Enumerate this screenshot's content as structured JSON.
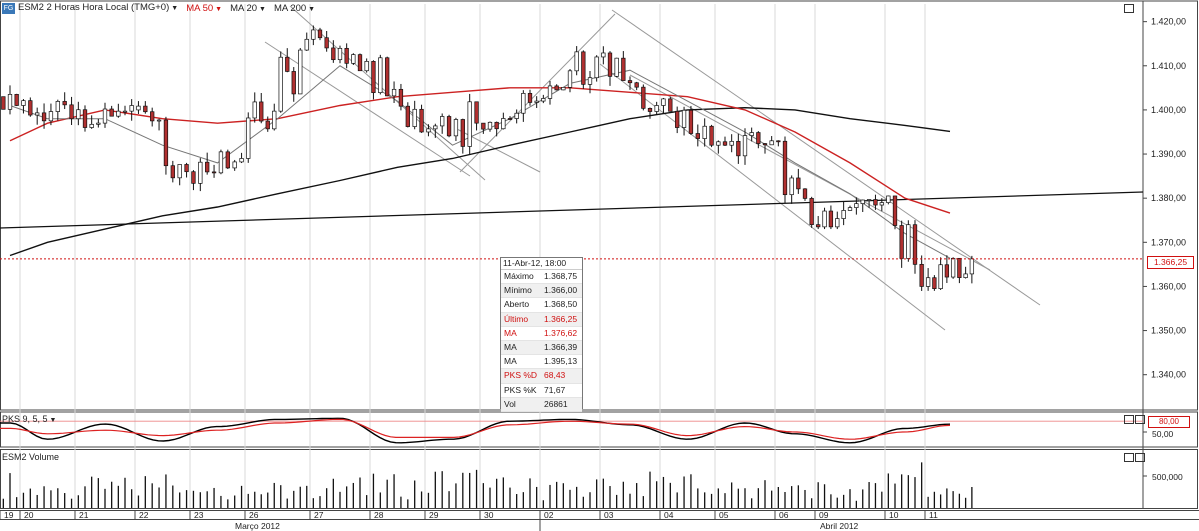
{
  "header": {
    "symbol_title": "ESM2 2 Horas Hora Local (TMG+0)",
    "ma50": "MA 50",
    "ma20": "MA 20",
    "ma200": "MA 200"
  },
  "tooltip": {
    "title": "11-Abr-12, 18:00",
    "rows": [
      {
        "k": "Máximo",
        "v": "1.368,75",
        "red": false
      },
      {
        "k": "Mínimo",
        "v": "1.366,00",
        "red": false
      },
      {
        "k": "Aberto",
        "v": "1.368,50",
        "red": false
      },
      {
        "k": "Último",
        "v": "1.366,25",
        "red": true
      },
      {
        "k": "MA",
        "v": "1.376,62",
        "red": true
      },
      {
        "k": "MA",
        "v": "1.366,39",
        "red": false
      },
      {
        "k": "MA",
        "v": "1.395,13",
        "red": false
      },
      {
        "k": "PKS %D",
        "v": "68,43",
        "red": true
      },
      {
        "k": "PKS %K",
        "v": "71,67",
        "red": false
      },
      {
        "k": "Vol",
        "v": "26861",
        "red": false
      }
    ]
  },
  "price_badge": "1.366,25",
  "pks_panel": {
    "label": "PKS 9, 5, 5",
    "badge": "80,00",
    "tick": "50,00"
  },
  "volume_panel": {
    "label": "ESM2 Volume",
    "tick": "500,000"
  },
  "colors": {
    "up": "#ffffff",
    "down": "#b03030",
    "ma50": "#cc2222",
    "ma20": "#777777",
    "ma200": "#111111",
    "k": "#000000",
    "d": "#dd2222"
  },
  "chart_data": {
    "type": "candlestick",
    "y_ticks": [
      "1.420,00",
      "1.410,00",
      "1.400,00",
      "1.390,00",
      "1.380,00",
      "1.370,00",
      "1.360,00",
      "1.350,00",
      "1.340,00"
    ],
    "y_tick_values": [
      1420,
      1410,
      1400,
      1390,
      1380,
      1370,
      1360,
      1350,
      1340
    ],
    "ylim": [
      1332,
      1424
    ],
    "last_price": 1366.25,
    "day_labels": [
      "19",
      "20",
      "21",
      "22",
      "23",
      "26",
      "27",
      "28",
      "29",
      "30",
      "02",
      "03",
      "04",
      "05",
      "06",
      "09",
      "10",
      "11"
    ],
    "month_labels": [
      "Março 2012",
      "Abril 2012"
    ],
    "days": [
      {
        "o": 1403,
        "h": 1407,
        "l": 1399,
        "c": 1401
      },
      {
        "o": 1401,
        "h": 1404,
        "l": 1392,
        "c": 1398
      },
      {
        "o": 1398,
        "h": 1405,
        "l": 1395,
        "c": 1401
      },
      {
        "o": 1400,
        "h": 1402,
        "l": 1382,
        "c": 1386
      },
      {
        "o": 1386,
        "h": 1391,
        "l": 1380,
        "c": 1389
      },
      {
        "o": 1389,
        "h": 1418,
        "l": 1388,
        "c": 1416
      },
      {
        "o": 1416,
        "h": 1420,
        "l": 1408,
        "c": 1411
      },
      {
        "o": 1411,
        "h": 1413,
        "l": 1389,
        "c": 1395
      },
      {
        "o": 1395,
        "h": 1405,
        "l": 1386,
        "c": 1397
      },
      {
        "o": 1397,
        "h": 1408,
        "l": 1394,
        "c": 1402
      },
      {
        "o": 1402,
        "h": 1418,
        "l": 1400,
        "c": 1412
      },
      {
        "o": 1412,
        "h": 1416,
        "l": 1398,
        "c": 1401
      },
      {
        "o": 1401,
        "h": 1403,
        "l": 1388,
        "c": 1392
      },
      {
        "o": 1392,
        "h": 1396,
        "l": 1385,
        "c": 1393
      },
      {
        "o": 1393,
        "h": 1395,
        "l": 1372,
        "c": 1374
      },
      {
        "o": 1374,
        "h": 1383,
        "l": 1373,
        "c": 1379
      },
      {
        "o": 1379,
        "h": 1381,
        "l": 1352,
        "c": 1360
      },
      {
        "o": 1360,
        "h": 1370,
        "l": 1359,
        "c": 1366.25
      }
    ],
    "ma50": [
      1393,
      1397,
      1400,
      1398,
      1397,
      1398,
      1401,
      1403,
      1404,
      1405,
      1405,
      1404,
      1403,
      1400,
      1395,
      1388,
      1380,
      1376.62
    ],
    "ma20": [
      1401,
      1398,
      1398,
      1392,
      1388,
      1398,
      1410,
      1402,
      1392,
      1398,
      1406,
      1409,
      1402,
      1395,
      1388,
      1381,
      1372,
      1366.39
    ],
    "ma200": [
      1367,
      1370,
      1373,
      1376,
      1378,
      1381,
      1384,
      1387,
      1389,
      1392,
      1395,
      1398,
      1400,
      1400.5,
      1400,
      1398,
      1396.5,
      1395.13
    ],
    "pks_k": [
      75,
      30,
      72,
      25,
      65,
      85,
      88,
      20,
      30,
      80,
      85,
      70,
      30,
      75,
      45,
      20,
      60,
      71.67
    ],
    "pks_d": [
      60,
      45,
      55,
      40,
      55,
      75,
      85,
      35,
      35,
      70,
      80,
      72,
      40,
      65,
      50,
      30,
      50,
      68.43
    ],
    "volume_rel": [
      0.7,
      0.5,
      0.6,
      0.7,
      0.6,
      0.5,
      0.6,
      0.65,
      0.8,
      0.6,
      0.55,
      0.7,
      0.65,
      0.6,
      0.55,
      0.5,
      1.0,
      0.4
    ]
  }
}
